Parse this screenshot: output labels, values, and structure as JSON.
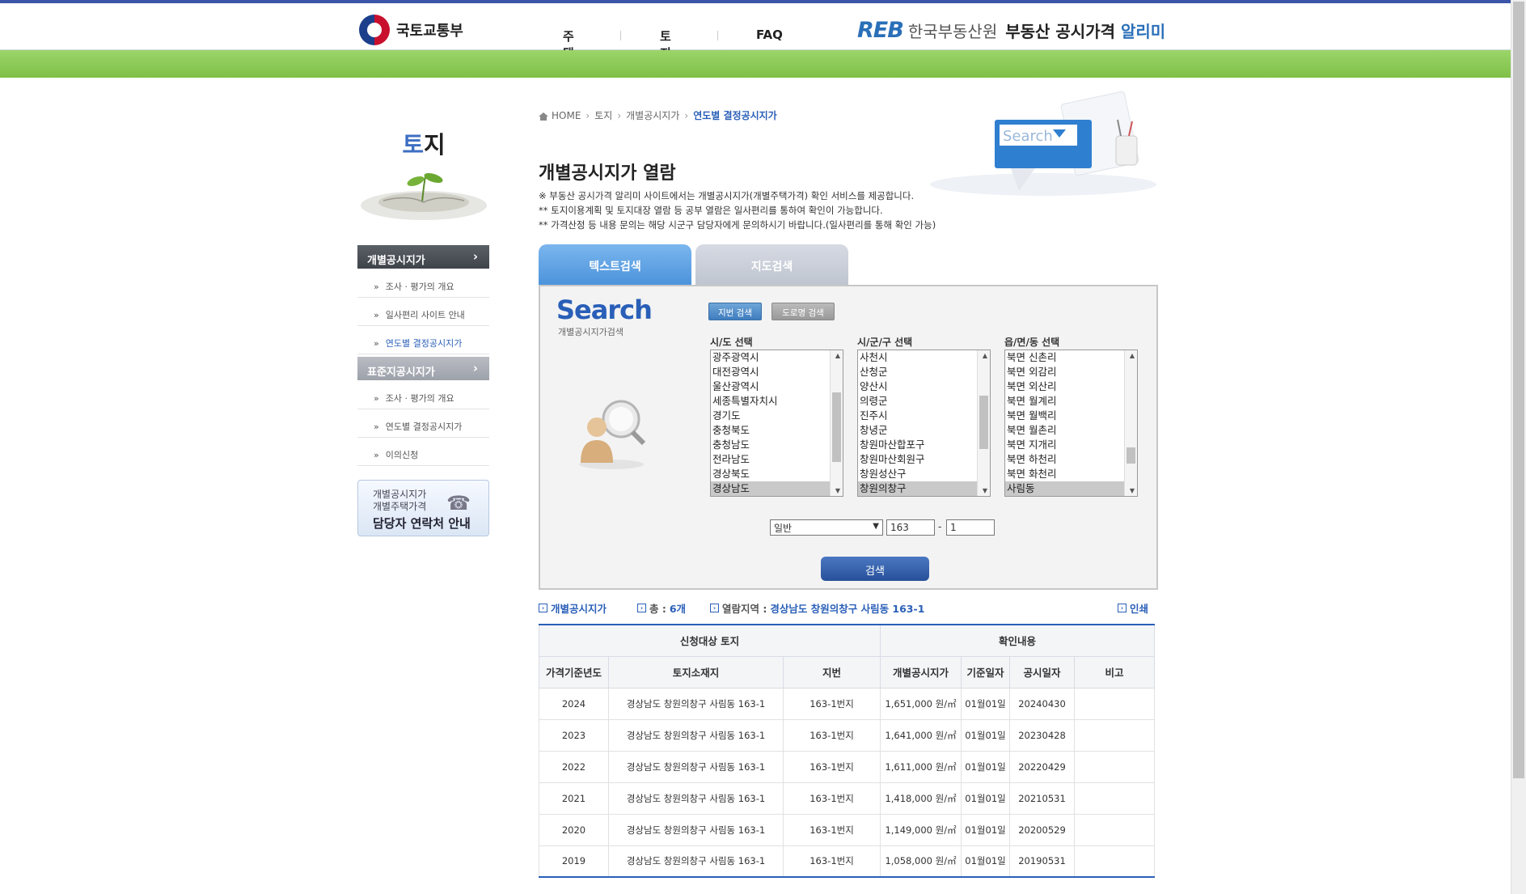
{
  "header": {
    "ministry_logo_text": "국토교통부",
    "nav": [
      "주택",
      "토지",
      "FAQ"
    ],
    "reb_mark": "REB",
    "reb_org": "한국부동산원",
    "site_title_main": "부동산 공시가격",
    "site_title_accent": "알리미"
  },
  "sidebar": {
    "title_accent": "토",
    "title_rest": "지",
    "section1": "개별공시지가",
    "section1_items": [
      "조사 · 평가의 개요",
      "일사편리 사이트 안내",
      "연도별 결정공시지가"
    ],
    "section2": "표준지공시지가",
    "section2_items": [
      "조사 · 평가의 개요",
      "연도별 결정공시지가",
      "이의신청"
    ],
    "contact_l1": "개별공시지가",
    "contact_l2": "개별주택가격",
    "contact_l3": "담당자 연락처 안내"
  },
  "breadcrumb": [
    "HOME",
    "토지",
    "개별공시지가",
    "연도별 결정공시지가"
  ],
  "page": {
    "title": "개별공시지가 열람",
    "notice1": "※ 부동산 공시가격 알리미 사이트에서는 개별공시지가(개별주택가격) 확인 서비스를 제공합니다.",
    "notice2": "** 토지이용계획 및 토지대장 열람 등 공부 열람은 일사편리를 통하여 확인이 가능합니다.",
    "notice3": "** 가격산정 등 내용 문의는 해당 시군구 담당자에게 문의하시기 바랍니다.(일사편리를 통해 확인 가능)",
    "hero_search_text": "Search"
  },
  "tabs": [
    "텍스트검색",
    "지도검색"
  ],
  "search": {
    "heading": "Search",
    "subheading": "개별공시지가검색",
    "btn_jibun": "지번 검색",
    "btn_road": "도로명 검색",
    "label_sido": "시/도 선택",
    "label_sigungu": "시/군/구 선택",
    "label_dong": "읍/면/동 선택",
    "sido_options": [
      "광주광역시",
      "대전광역시",
      "울산광역시",
      "세종특별자치시",
      "경기도",
      "충청북도",
      "충청남도",
      "전라남도",
      "경상북도",
      "경상남도"
    ],
    "sido_selected": "경상남도",
    "sigungu_options": [
      "사천시",
      "산청군",
      "양산시",
      "의령군",
      "진주시",
      "창녕군",
      "창원마산합포구",
      "창원마산회원구",
      "창원성산구",
      "창원의창구"
    ],
    "sigungu_selected": "창원의창구",
    "dong_options": [
      "북면 신촌리",
      "북면 외감리",
      "북면 외산리",
      "북면 월계리",
      "북면 월백리",
      "북면 월촌리",
      "북면 지개리",
      "북면 하천리",
      "북면 화천리",
      "사림동"
    ],
    "dong_selected": "사림동",
    "type_value": "일반",
    "bun": "163",
    "ji": "1",
    "dash": "-",
    "submit": "검색"
  },
  "result_bar": {
    "label": "개별공시지가",
    "total_label": "총 :",
    "total_value": "6개",
    "region_label": "열람지역 :",
    "region_value": "경상남도 창원의창구 사림동 163-1",
    "print": "인쇄"
  },
  "table": {
    "group1": "신청대상 토지",
    "group2": "확인내용",
    "columns": [
      "가격기준년도",
      "토지소재지",
      "지번",
      "개별공시지가",
      "기준일자",
      "공시일자",
      "비고"
    ],
    "rows": [
      [
        "2024",
        "경상남도 창원의창구 사림동 163-1",
        "163-1번지",
        "1,651,000 원/㎡",
        "01월01일",
        "20240430",
        ""
      ],
      [
        "2023",
        "경상남도 창원의창구 사림동 163-1",
        "163-1번지",
        "1,641,000 원/㎡",
        "01월01일",
        "20230428",
        ""
      ],
      [
        "2022",
        "경상남도 창원의창구 사림동 163-1",
        "163-1번지",
        "1,611,000 원/㎡",
        "01월01일",
        "20220429",
        ""
      ],
      [
        "2021",
        "경상남도 창원의창구 사림동 163-1",
        "163-1번지",
        "1,418,000 원/㎡",
        "01월01일",
        "20210531",
        ""
      ],
      [
        "2020",
        "경상남도 창원의창구 사림동 163-1",
        "163-1번지",
        "1,149,000 원/㎡",
        "01월01일",
        "20200529",
        ""
      ],
      [
        "2019",
        "경상남도 창원의창구 사림동 163-1",
        "163-1번지",
        "1,058,000 원/㎡",
        "01월01일",
        "20190531",
        ""
      ]
    ]
  },
  "colors": {
    "brand_blue": "#2a5fb8",
    "green_band": "#8ccb58",
    "tab_active": "#4c93db"
  }
}
